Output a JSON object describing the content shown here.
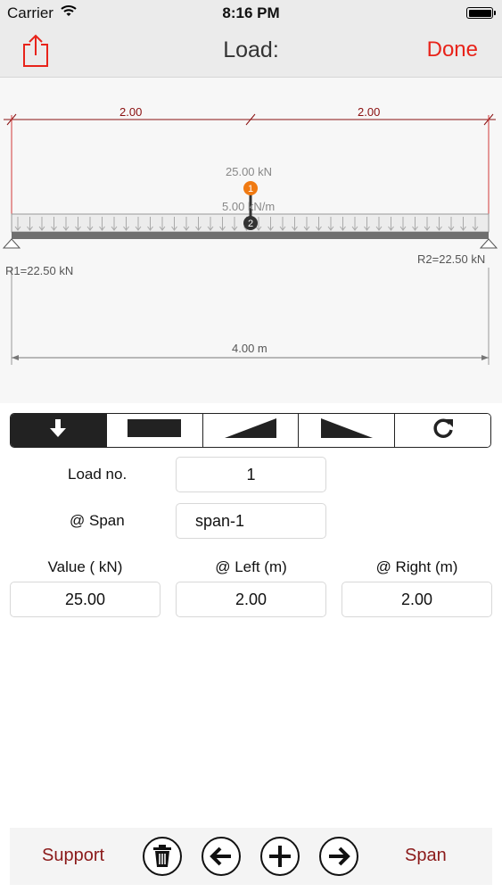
{
  "status": {
    "carrier": "Carrier",
    "time": "8:16 PM"
  },
  "nav": {
    "title": "Load:",
    "done": "Done"
  },
  "diagram": {
    "dim_left": "2.00",
    "dim_right": "2.00",
    "point_load": "25.00 kN",
    "point_marker": "1",
    "dist_load": "5.00 kN/m",
    "dist_marker": "2",
    "reaction_left": "R1=22.50 kN",
    "reaction_right": "R2=22.50 kN",
    "total_length": "4.00 m"
  },
  "load_types": [
    {
      "name": "point-load",
      "icon": "arrow-down-icon",
      "active": true
    },
    {
      "name": "uniform-load",
      "icon": "rectangle-icon",
      "active": false
    },
    {
      "name": "triangular-increasing-load",
      "icon": "triangle-up-icon",
      "active": false
    },
    {
      "name": "triangular-decreasing-load",
      "icon": "triangle-down-icon",
      "active": false
    },
    {
      "name": "moment-load",
      "icon": "rotate-icon",
      "active": false
    }
  ],
  "form": {
    "load_no_label": "Load no.",
    "load_no_value": "1",
    "span_label": "@ Span",
    "span_value": "span-1",
    "value_label": "Value ( kN)",
    "value_value": "25.00",
    "left_label": "@ Left (m)",
    "left_value": "2.00",
    "right_label": "@ Right (m)",
    "right_value": "2.00"
  },
  "toolbar": {
    "support": "Support",
    "span": "Span",
    "icons": [
      "trash-icon",
      "arrow-left-icon",
      "plus-icon",
      "arrow-right-icon"
    ]
  },
  "colors": {
    "accent": "#e8231a",
    "toolbar_text": "#8b1a1a",
    "point_load": "#f07a12"
  }
}
